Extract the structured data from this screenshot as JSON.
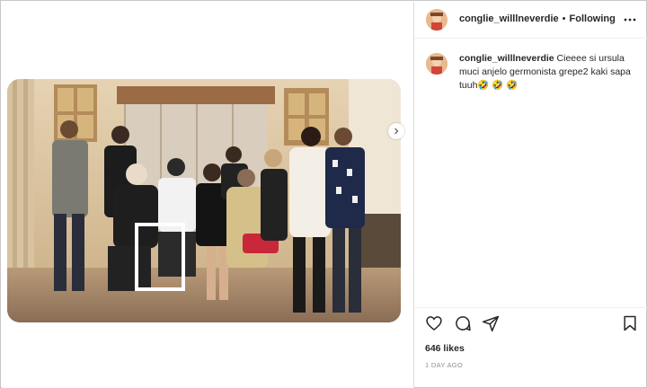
{
  "post": {
    "username": "conglie_willlneverdie",
    "separator": "•",
    "follow_status": "Following",
    "caption_username": "conglie_willlneverdie",
    "caption_text": "Cieeee si ursula muci anjelo germonista grepe2 kaki sapa tuuh🤣 🤣 🤣",
    "likes": "646 likes",
    "time_ago": "1 DAY AGO"
  },
  "icons": {
    "more": "more-options-icon",
    "like": "heart-icon",
    "comment": "comment-icon",
    "share": "send-icon",
    "save": "bookmark-icon",
    "next": "chevron-right-icon"
  },
  "colors": {
    "text": "#262626",
    "muted": "#8e8e8e",
    "border": "#dbdbdb",
    "highlight_box": "#ffffff"
  }
}
